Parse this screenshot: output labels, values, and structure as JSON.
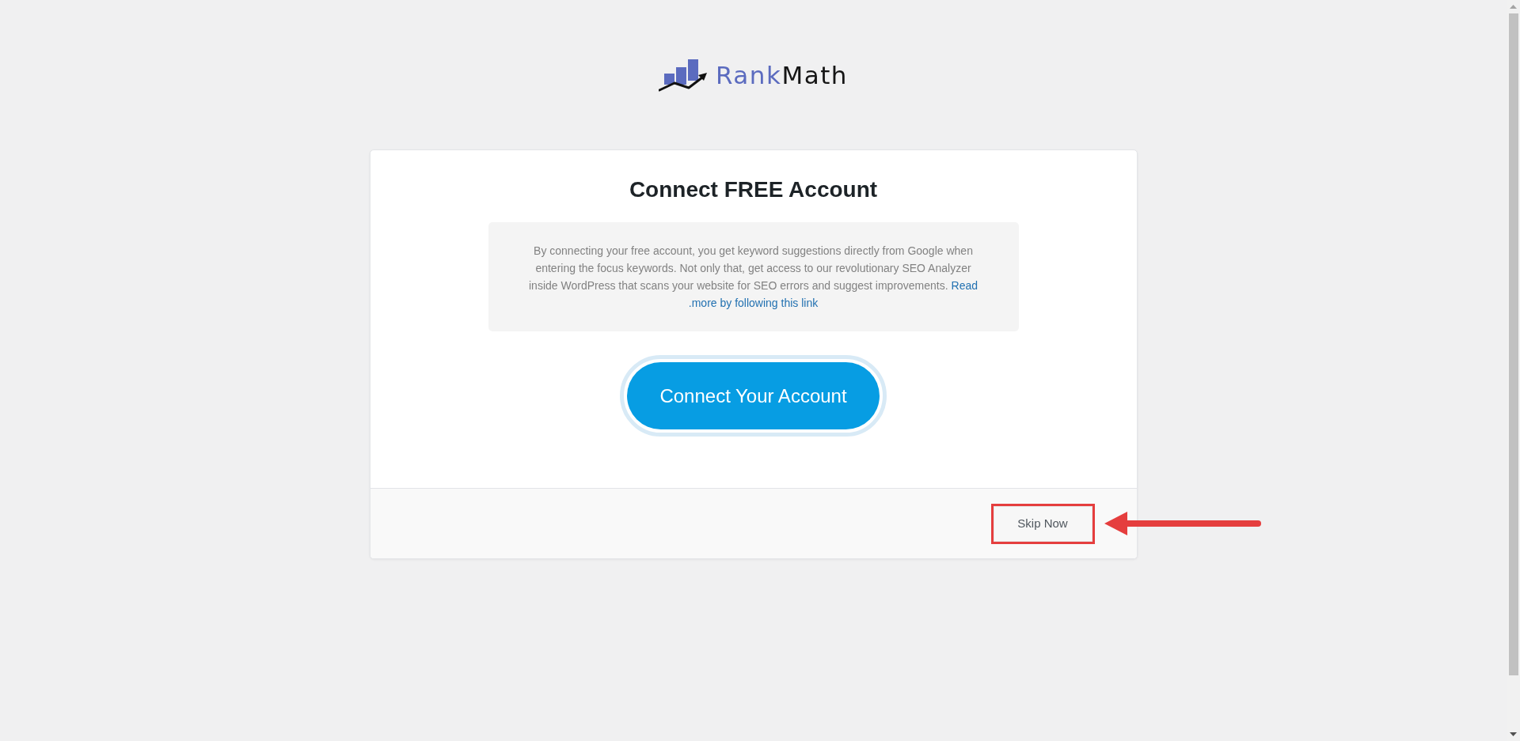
{
  "logo": {
    "wordmark": [
      "Rank",
      "Math"
    ]
  },
  "card": {
    "title": "Connect FREE Account",
    "description": {
      "text": "By connecting your free account, you get keyword suggestions directly from Google when entering the focus keywords. Not only that, get access to our revolutionary SEO Analyzer inside WordPress that scans your website for SEO errors and suggest improvements.",
      "link": [
        "Read",
        ".more by following this link"
      ]
    },
    "primary_button": "Connect Your Account",
    "footer": {
      "skip_button": "Skip Now"
    }
  }
}
